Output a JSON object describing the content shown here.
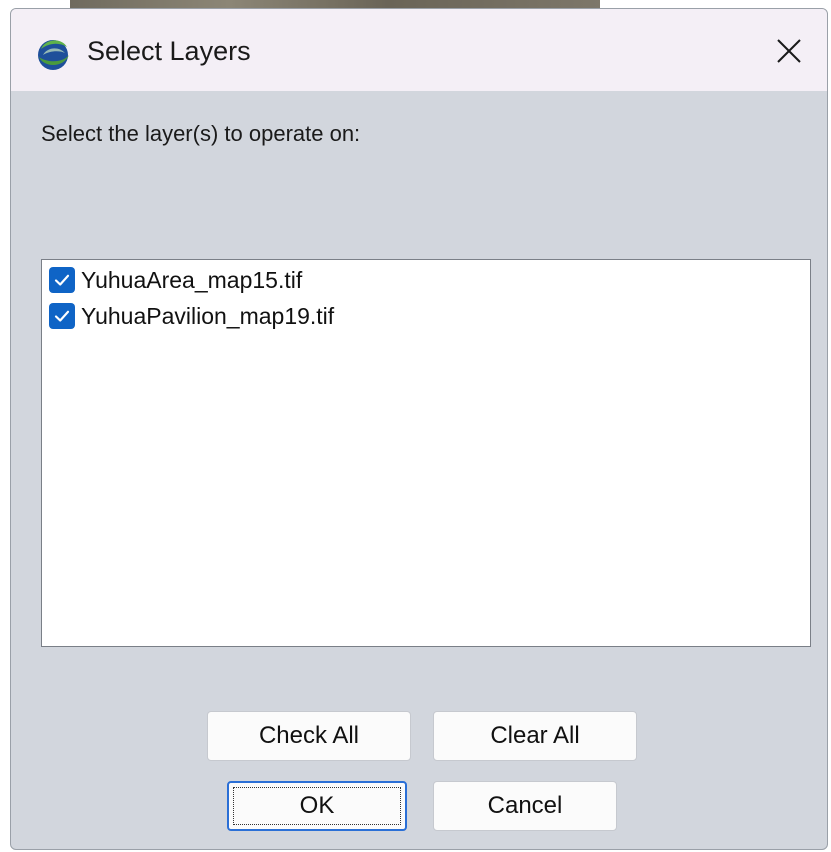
{
  "window": {
    "title": "Select Layers",
    "app_icon": "globe-swirl-icon",
    "close_icon": "close-icon"
  },
  "dialog": {
    "prompt": "Select the layer(s) to operate on:",
    "layers": [
      {
        "label": "YuhuaArea_map15.tif",
        "checked": true
      },
      {
        "label": "YuhuaPavilion_map19.tif",
        "checked": true
      }
    ],
    "buttons": {
      "check_all": "Check All",
      "clear_all": "Clear All",
      "ok": "OK",
      "cancel": "Cancel"
    }
  },
  "colors": {
    "checkbox_fill": "#0f64c6",
    "dialog_bg": "#d2d6dd",
    "titlebar_bg": "#f4eff6"
  }
}
